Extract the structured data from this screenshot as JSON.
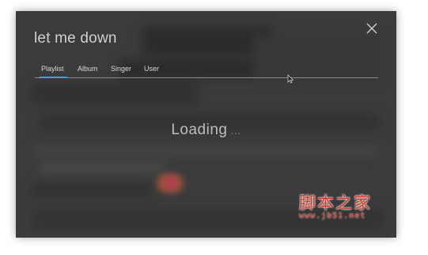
{
  "search": {
    "query": "let me down"
  },
  "tabs": [
    {
      "label": "Playlist",
      "active": true
    },
    {
      "label": "Album",
      "active": false
    },
    {
      "label": "Singer",
      "active": false
    },
    {
      "label": "User",
      "active": false
    }
  ],
  "status": {
    "loading_text": "Loading",
    "dots": "..."
  },
  "watermark": {
    "name": "脚本之家",
    "url": "www.jb51.net"
  },
  "colors": {
    "accent": "#3aa3e8",
    "overlay": "#3b3b3c",
    "watermark": "#d33b2a"
  },
  "icons": {
    "close": "close-icon",
    "cursor": "mouse-cursor-icon"
  }
}
